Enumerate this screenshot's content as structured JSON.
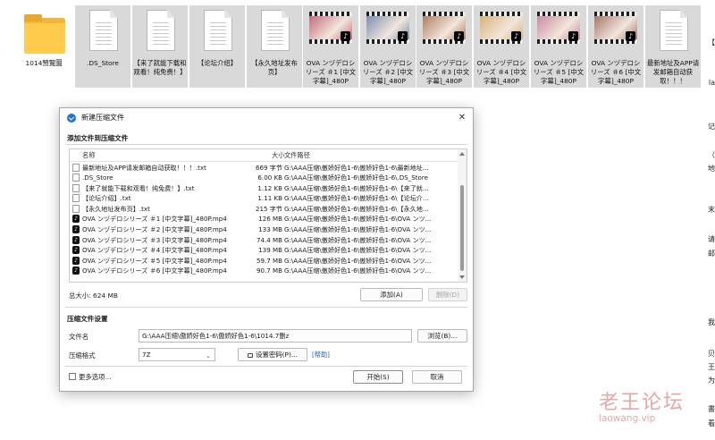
{
  "desktop": {
    "files": [
      {
        "label": "1014預覽圖",
        "type": "folder"
      },
      {
        "label": ".DS_Store",
        "type": "doc"
      },
      {
        "label": "【来了就能下载和观看！纯免费！】",
        "type": "doc"
      },
      {
        "label": "【论坛介绍】",
        "type": "doc"
      },
      {
        "label": "【永久地址发布页】",
        "type": "doc"
      },
      {
        "label": "OVA ンヅデロシリーズ ＃1 [中文字幕]_480P",
        "type": "video",
        "color": "#c56b7a"
      },
      {
        "label": "OVA ンヅデロシリーズ ＃2 [中文字幕]_480P",
        "type": "video",
        "color": "#7c8fb0"
      },
      {
        "label": "OVA ンヅデロシリーズ ＃3 [中文字幕]_480P",
        "type": "video",
        "color": "#b08060"
      },
      {
        "label": "OVA ンヅデロシリーズ ＃4 [中文字幕]_480P",
        "type": "video",
        "color": "#d8b27a"
      },
      {
        "label": "OVA ンヅデロシリーズ ＃5 [中文字幕]_480P",
        "type": "video",
        "color": "#c98aa4"
      },
      {
        "label": "OVA ンヅデロシリーズ ＃6 [中文字幕]_480P",
        "type": "video",
        "color": "#a6786a"
      },
      {
        "label": "最新地址及APP请发邮箱自动获取！！！",
        "type": "doc"
      }
    ]
  },
  "side_text": [
    "【",
    "la",
    "记",
    "（",
    "地",
    "末",
    "请",
    "邮",
    "我",
    "贝",
    "王",
    "为",
    "書",
    "看"
  ],
  "watermark": {
    "cn": "老王论坛",
    "en": "laowang.vip"
  },
  "dialog": {
    "title": "新建压缩文件",
    "close": "✕",
    "add_section": "添加文件到压缩文件",
    "columns": {
      "name": "名称",
      "size": "大小",
      "path": "文件路径"
    },
    "rows": [
      {
        "icon": "txt",
        "name": "最新地址及APP请发邮箱自动获取！！！.txt",
        "size": "669 字节",
        "path": "G:\\AAA压缩\\傲娇好色1-6\\傲娇好色1-6\\最新地址..."
      },
      {
        "icon": "txt",
        "name": ".DS_Store",
        "size": "6.00 KB",
        "path": "G:\\AAA压缩\\傲娇好色1-6\\傲娇好色1-6\\.DS_Store"
      },
      {
        "icon": "txt",
        "name": "【来了就能下载和观看！纯免费！】.txt",
        "size": "1.12 KB",
        "path": "G:\\AAA压缩\\傲娇好色1-6\\傲娇好色1-6\\【来了就..."
      },
      {
        "icon": "txt",
        "name": "【论坛介绍】.txt",
        "size": "1.11 KB",
        "path": "G:\\AAA压缩\\傲娇好色1-6\\傲娇好色1-6\\【论坛介..."
      },
      {
        "icon": "txt",
        "name": "【永久地址发布页】.txt",
        "size": "215 字节",
        "path": "G:\\AAA压缩\\傲娇好色1-6\\傲娇好色1-6\\【永久地..."
      },
      {
        "icon": "mp4",
        "name": "OVA ンヅデロシリーズ ＃1 [中文字幕]_480P.mp4",
        "size": "126 MB",
        "path": "G:\\AAA压缩\\傲娇好色1-6\\傲娇好色1-6\\OVA ンツ..."
      },
      {
        "icon": "mp4",
        "name": "OVA ンヅデロシリーズ ＃2 [中文字幕]_480P.mp4",
        "size": "133 MB",
        "path": "G:\\AAA压缩\\傲娇好色1-6\\傲娇好色1-6\\OVA ンツ..."
      },
      {
        "icon": "mp4",
        "name": "OVA ンヅデロシリーズ ＃3 [中文字幕]_480P.mp4",
        "size": "74.4 MB",
        "path": "G:\\AAA压缩\\傲娇好色1-6\\傲娇好色1-6\\OVA ンツ..."
      },
      {
        "icon": "mp4",
        "name": "OVA ンヅデロシリーズ ＃4 [中文字幕]_480P.mp4",
        "size": "139 MB",
        "path": "G:\\AAA压缩\\傲娇好色1-6\\傲娇好色1-6\\OVA ンツ..."
      },
      {
        "icon": "mp4",
        "name": "OVA ンヅデロシリーズ ＃5 [中文字幕]_480P.mp4",
        "size": "59.7 MB",
        "path": "G:\\AAA压缩\\傲娇好色1-6\\傲娇好色1-6\\OVA ンツ..."
      },
      {
        "icon": "mp4",
        "name": "OVA ンヅデロシリーズ ＃6 [中文字幕]_480P.mp4",
        "size": "90.7 MB",
        "path": "G:\\AAA压缩\\傲娇好色1-6\\傲娇好色1-6\\OVA ンツ..."
      }
    ],
    "total": "总大小: 624 MB",
    "add_button": "添加(A)",
    "delete_button": "删除(D)",
    "settings_section": "压缩文件设置",
    "filename_label": "文件名",
    "filename_value": "G:\\AAA压缩\\傲娇好色1-6\\傲娇好色1-6\\1014.7删z",
    "browse_button": "浏览(B)...",
    "format_label": "压缩格式",
    "format_value": "7Z",
    "password_button": "设置密码(P)...",
    "help_link": "[帮助]",
    "more_options": "更多选项...",
    "ok_button": "开始(S)",
    "cancel_button": "取消"
  }
}
